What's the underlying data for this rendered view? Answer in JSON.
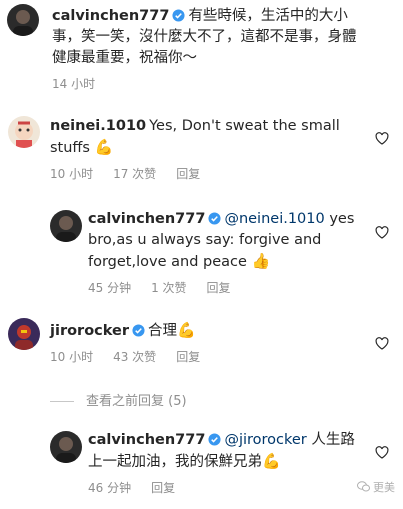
{
  "colors": {
    "mention": "#00376b",
    "verified": "#3897f0",
    "meta": "#8e8e8e"
  },
  "comments": [
    {
      "username": "calvinchen777",
      "verified": true,
      "mention": "",
      "text": "有些時候，生活中的大小事，笑一笑，沒什麼大不了，這都不是事，身體健康最重要，祝福你～",
      "time": "14 小时",
      "likes": "",
      "reply": "",
      "heart": false
    },
    {
      "username": "neinei.1010",
      "verified": false,
      "mention": "",
      "text": "Yes, Don't sweat the small stuffs ",
      "emoji": "💪",
      "time": "10 小时",
      "likes": "17 次赞",
      "reply": "回复",
      "heart": true
    },
    {
      "username": "calvinchen777",
      "verified": true,
      "mention": "@neinei.1010",
      "text": " yes bro,as u always say: forgive and forget,love and peace ",
      "emoji": "👍",
      "time": "45 分钟",
      "likes": "1 次赞",
      "reply": "回复",
      "heart": true
    },
    {
      "username": "jirorocker",
      "verified": true,
      "mention": "",
      "text": "合理",
      "emoji": "💪",
      "time": "10 小时",
      "likes": "43 次赞",
      "reply": "回复",
      "heart": true
    },
    {
      "username": "calvinchen777",
      "verified": true,
      "mention": "@jirorocker",
      "text": " 人生路上一起加油，我的保鮮兄弟",
      "emoji": "💪",
      "time": "46 分钟",
      "likes": "",
      "reply": "回复",
      "heart": true
    }
  ],
  "view_replies": "查看之前回复 (5)",
  "watermark": "更美"
}
